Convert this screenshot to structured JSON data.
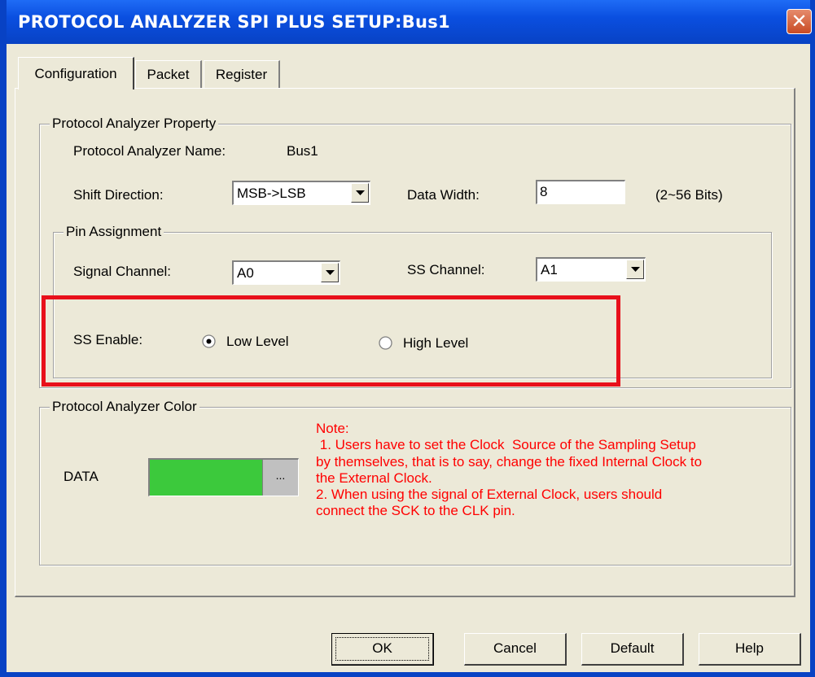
{
  "window": {
    "title": "PROTOCOL ANALYZER SPI PLUS SETUP:Bus1",
    "close_glyph": "✕"
  },
  "tabs": [
    {
      "label": "Configuration",
      "active": true
    },
    {
      "label": "Packet",
      "active": false
    },
    {
      "label": "Register",
      "active": false
    }
  ],
  "property": {
    "legend": "Protocol Analyzer Property",
    "name_label": "Protocol Analyzer Name:",
    "name_value": "Bus1",
    "shift_label": "Shift Direction:",
    "shift_value": "MSB->LSB",
    "width_label": "Data Width:",
    "width_value": "8",
    "width_hint": "(2~56 Bits)"
  },
  "pins": {
    "legend": "Pin Assignment",
    "signal_label": "Signal Channel:",
    "signal_value": "A0",
    "ss_label": "SS Channel:",
    "ss_value": "A1",
    "ss_enable_label": "SS Enable:",
    "low_label": "Low Level",
    "high_label": "High Level",
    "selected": "low"
  },
  "color": {
    "legend": "Protocol Analyzer Color",
    "data_label": "DATA",
    "data_color": "#3cc93c",
    "picker_label": "...",
    "note": "Note:\n 1. Users have to set the Clock  Source of the Sampling Setup\nby themselves, that is to say, change the fixed Internal Clock to\nthe External Clock.\n2. When using the signal of External Clock, users should\nconnect the SCK to the CLK pin."
  },
  "buttons": {
    "ok": "OK",
    "cancel": "Cancel",
    "default": "Default",
    "help": "Help"
  },
  "colors": {
    "titlebar": "#0842c4",
    "highlight": "#e8101b",
    "note": "#ff0000",
    "face": "#ece9d8"
  }
}
